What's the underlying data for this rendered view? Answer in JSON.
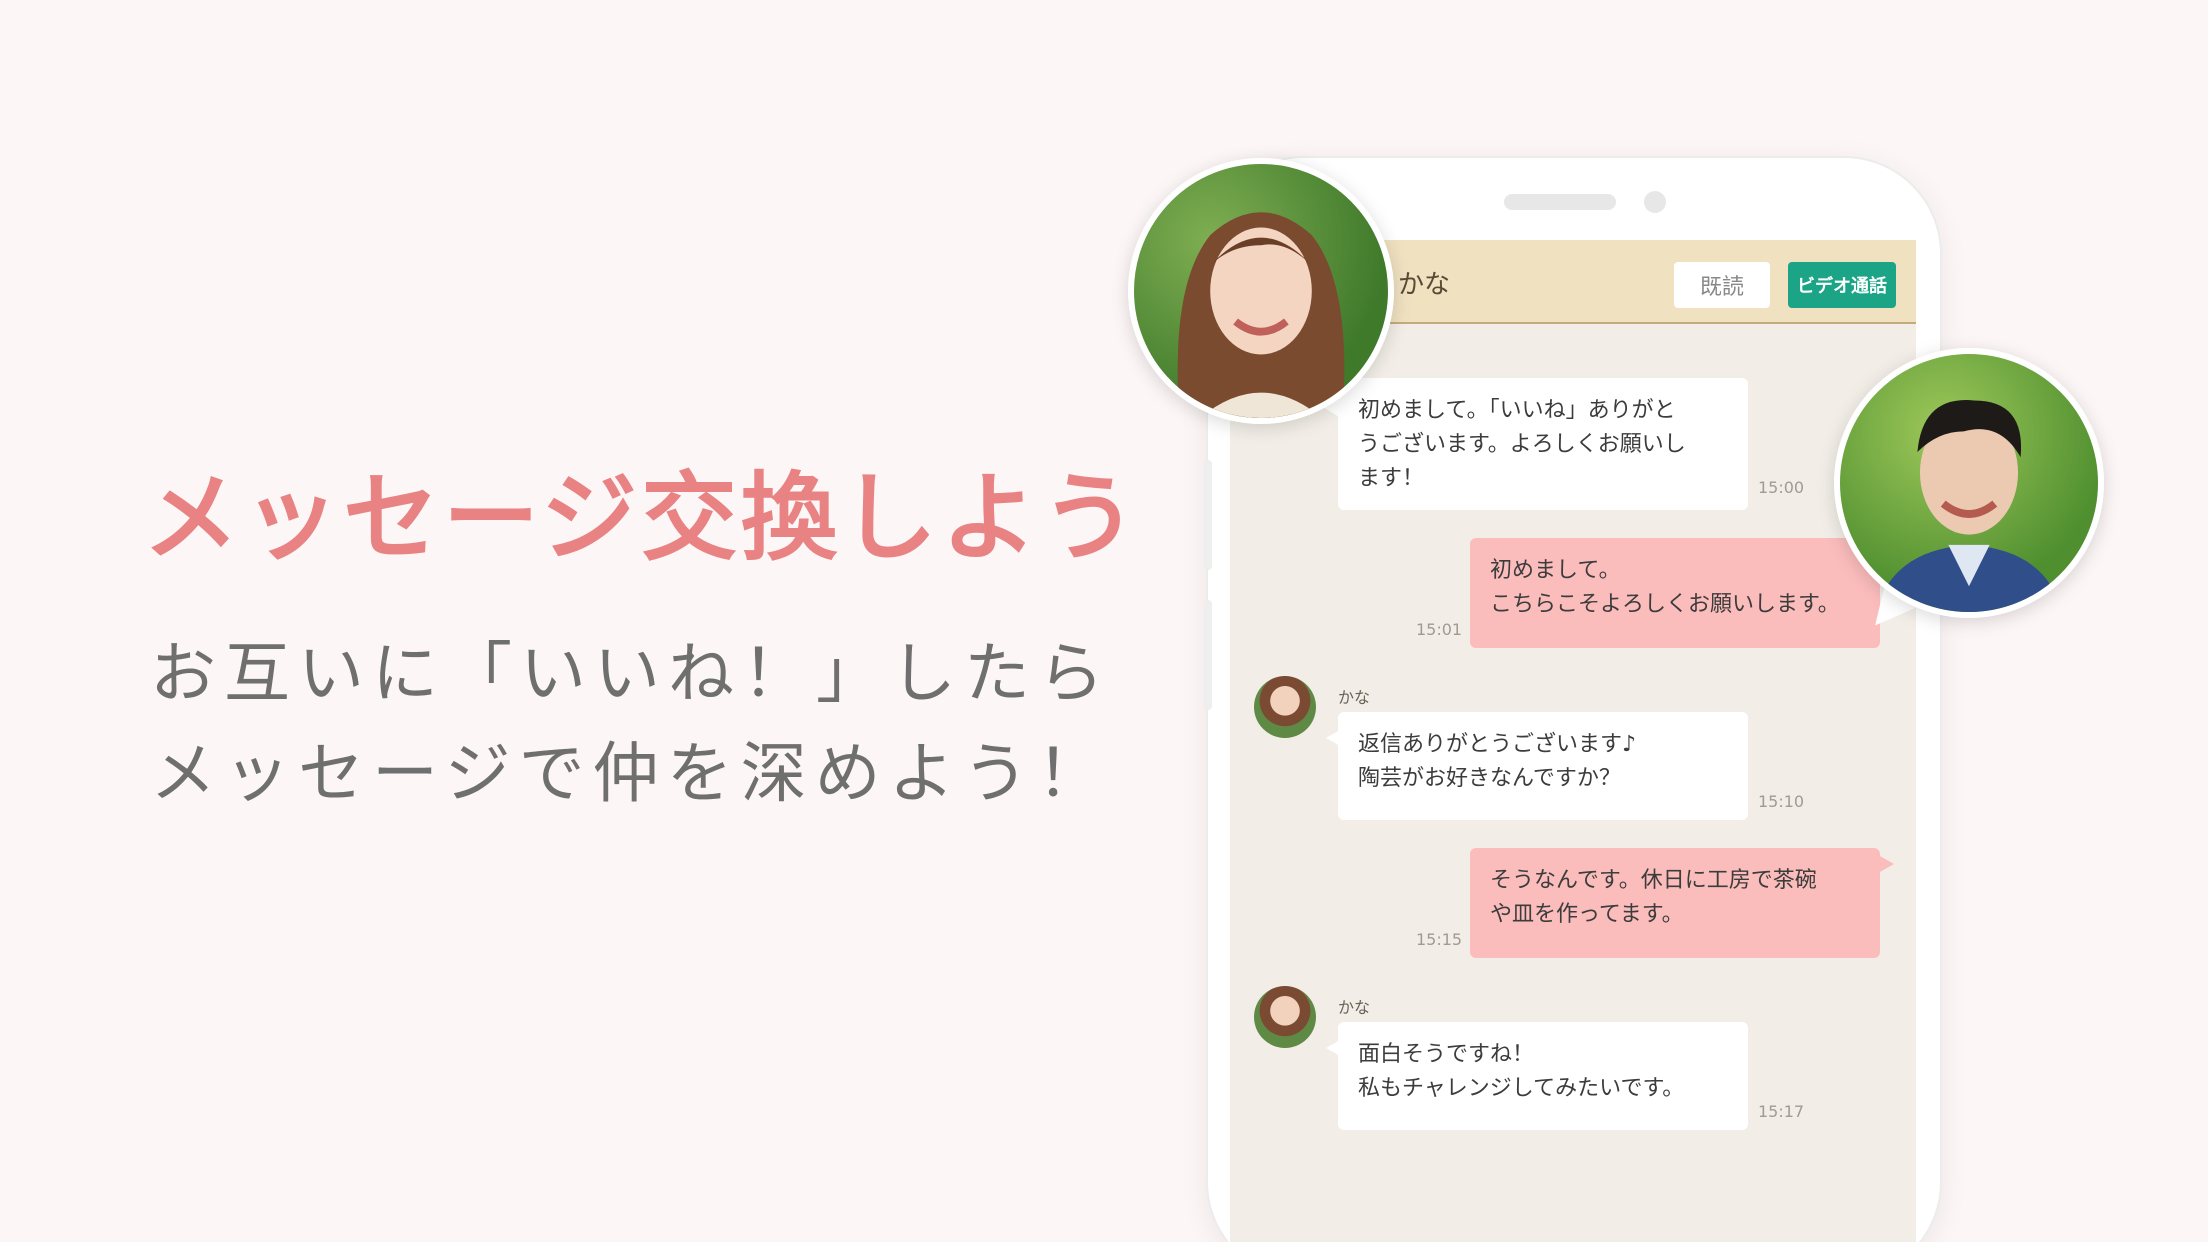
{
  "promo": {
    "headline": "メッセージ交換しよう",
    "sub_line_1": "お互いに「いいね！」したら",
    "sub_line_2": "メッセージで仲を深めよう！"
  },
  "chat": {
    "partner_name": "かな",
    "read_label": "既読",
    "video_call_label": "ビデオ通話",
    "messages": [
      {
        "from": "partner",
        "text": "初めまして。「いいね」ありがと\nうございます。よろしくお願いし\nます！",
        "time": "15:00"
      },
      {
        "from": "me",
        "text": "初めまして。\nこちらこそよろしくお願いします。",
        "time": "15:01"
      },
      {
        "from": "partner",
        "sender": "かな",
        "text": "返信ありがとうございます♪\n陶芸がお好きなんですか？",
        "time": "15:10"
      },
      {
        "from": "me",
        "text": "そうなんです。休日に工房で茶碗\nや皿を作ってます。",
        "time": "15:15"
      },
      {
        "from": "partner",
        "sender": "かな",
        "text": "面白そうですね！\n私もチャレンジしてみたいです。",
        "time": "15:17"
      }
    ]
  },
  "colors": {
    "headline": "#e88283",
    "header_bg": "#f0e1c1",
    "video_call": "#1ba485",
    "my_bubble": "#fbbcbc",
    "chat_bg": "#f2eee7"
  }
}
